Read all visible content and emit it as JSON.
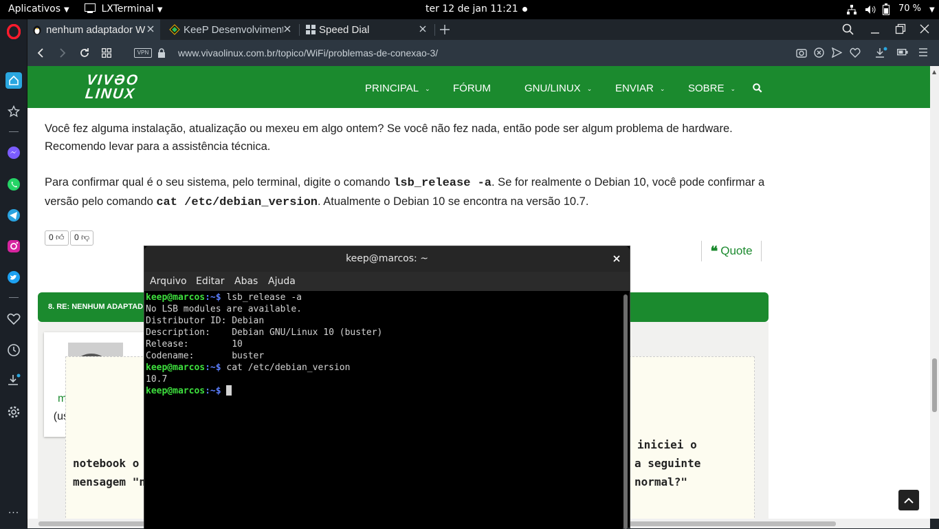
{
  "panel": {
    "apps_menu": "Aplicativos",
    "active_window": "LXTerminal",
    "clock": "ter 12 de jan  11:21",
    "battery": "70 %"
  },
  "browser": {
    "tabs": [
      {
        "title": "nenhum adaptador W",
        "icon": "penguin-icon"
      },
      {
        "title": "KeeP Desenvolviment",
        "icon": "keep-icon"
      },
      {
        "title": "Speed Dial",
        "icon": "grid-icon"
      }
    ],
    "vpn_label": "VPN",
    "url": "www.vivaolinux.com.br/topico/WiFi/problemas-de-conexao-3/"
  },
  "site": {
    "logo_line1": "VIVƏO",
    "logo_line2": "LINUX",
    "menu": [
      "PRINCIPAL",
      "FÓRUM",
      "GNU/LINUX",
      "ENVIAR",
      "SOBRE"
    ],
    "para1": "Você fez alguma instalação, atualização ou mexeu em algo ontem? Se você não fez nada, então pode ser algum problema de hardware. Recomendo levar para a assistência técnica.",
    "para2_a": "Para confirmar qual é o seu sistema, pelo terminal, digite o comando ",
    "para2_code1": "lsb_release -a",
    "para2_b": ". Se for realmente o Debian 10, você pode confirmar a versão pelo comando ",
    "para2_code2": "cat /etc/debian_version",
    "para2_c": ". Atualmente o Debian 10 se encontra na versão 10.7.",
    "votes_up": "0",
    "votes_down": "0",
    "quote_label": "Quote",
    "reply_header": "8. RE: NENHUM ADAPTAD",
    "username": "marcos_olimpio",
    "user_distro": "(usa PCLinuxOS)",
    "msg_left_1": "notebook o",
    "msg_left_2": "mensagem \"n",
    "msg_right_1": "iniciei o",
    "msg_right_2": "a seguinte",
    "msg_right_3": "normal?\""
  },
  "terminal": {
    "title": "keep@marcos: ~",
    "menu": [
      "Arquivo",
      "Editar",
      "Abas",
      "Ajuda"
    ],
    "prompt_user": "keep@marcos",
    "prompt_path": ":~$",
    "cmd1": " lsb_release -a",
    "out1": "No LSB modules are available.",
    "out2": "Distributor ID:\tDebian",
    "out3": "Description:\tDebian GNU/Linux 10 (buster)",
    "out4": "Release:\t10",
    "out5": "Codename:\tbuster",
    "cmd2": " cat /etc/debian_version",
    "out6": "10.7"
  },
  "colors": {
    "site_green": "#1b8a2e",
    "opera_red": "#ff1b2d",
    "prompt_green": "#3ee03e",
    "prompt_blue": "#5c7fff"
  }
}
